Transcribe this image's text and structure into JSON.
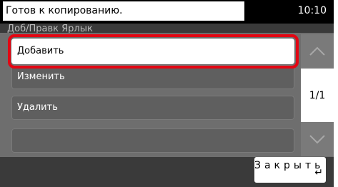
{
  "header": {
    "status_text": "Готов к копированию.",
    "time": "10:10"
  },
  "screen_title": "Доб/Правк Ярлык",
  "menu": {
    "items": [
      {
        "label": "Добавить"
      },
      {
        "label": "Изменить"
      },
      {
        "label": "Удалить"
      },
      {
        "label": ""
      }
    ]
  },
  "pager": {
    "page_indicator": "1/1",
    "up_icon": "chevron-up-icon",
    "down_icon": "chevron-down-icon"
  },
  "footer": {
    "close_label": "Закрыть"
  }
}
